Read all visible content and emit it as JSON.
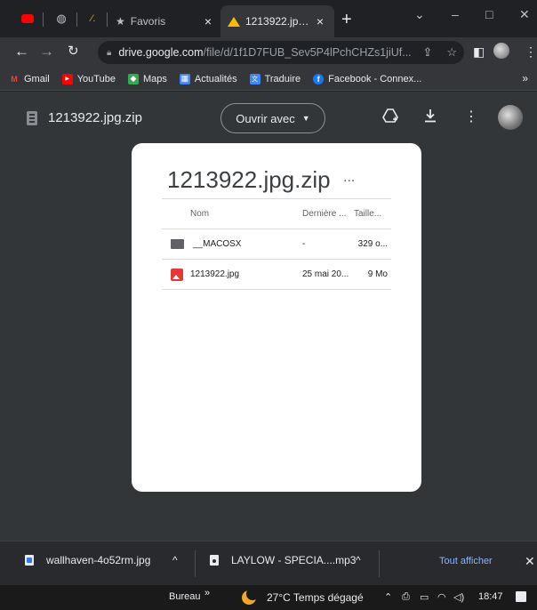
{
  "tabs": {
    "favoris_title": "Favoris",
    "active_title": "1213922.jpg.zip",
    "close_glyph": "×",
    "new_tab_glyph": "+"
  },
  "window": {
    "minimize": "–",
    "maximize": "□",
    "close": "✕",
    "tab_search": "⌄"
  },
  "omnibox": {
    "host": "drive.google.com",
    "path": "/file/d/1f1D7FUB_Sev5P4lPchCHZs1jiUf..."
  },
  "bookmarks": [
    {
      "label": "Gmail",
      "color": "#ea4335",
      "glyph": "M"
    },
    {
      "label": "YouTube",
      "color": "#ff0000",
      "glyph": "▶"
    },
    {
      "label": "Maps",
      "color": "#34a853",
      "glyph": "◆"
    },
    {
      "label": "Actualités",
      "color": "#4285f4",
      "glyph": "▦"
    },
    {
      "label": "Traduire",
      "color": "#4285f4",
      "glyph": "文"
    },
    {
      "label": "Facebook - Connex...",
      "color": "#1877f2",
      "glyph": "f"
    }
  ],
  "viewer": {
    "file_title": "1213922.jpg.zip",
    "open_with_label": "Ouvrir avec"
  },
  "zip": {
    "title": "1213922.jpg.zip",
    "more": "...",
    "columns": {
      "name": "Nom",
      "modified": "Dernière ...",
      "size": "Taille..."
    },
    "rows": [
      {
        "name": "__MACOSX",
        "modified": "-",
        "size": "329 o...",
        "type": "folder"
      },
      {
        "name": "1213922.jpg",
        "modified": "25 mai 20...",
        "size": "9 Mo",
        "type": "image"
      }
    ]
  },
  "downloads": {
    "items": [
      {
        "name": "wallhaven-4o52rm.jpg"
      },
      {
        "name": "LAYLOW - SPECIA....mp3"
      }
    ],
    "show_all": "Tout afficher"
  },
  "taskbar": {
    "bureau": "Bureau",
    "chevron": "»",
    "weather": "27°C  Temps dégagé",
    "clock": "18:47"
  }
}
